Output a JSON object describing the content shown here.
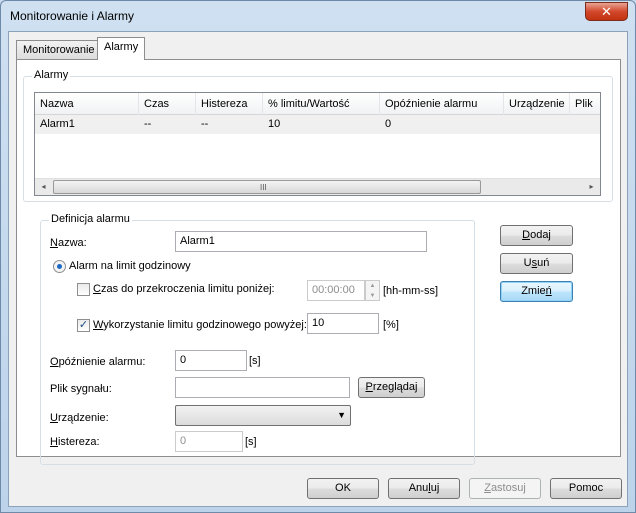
{
  "window": {
    "title": "Monitorowanie i Alarmy",
    "close_glyph": "✕"
  },
  "tabs": [
    {
      "label": "Monitorowanie"
    },
    {
      "label": "Alarmy"
    }
  ],
  "alarms_group": {
    "label": "Alarmy",
    "columns": [
      "Nazwa",
      "Czas",
      "Histereza",
      "% limitu/Wartość",
      "Opóźnienie alarmu",
      "Urządzenie",
      "Plik"
    ],
    "rows": [
      {
        "cells": [
          "Alarm1",
          "--",
          "--",
          "10",
          "0",
          "",
          ""
        ]
      }
    ],
    "scroll_left": "◂",
    "scroll_right": "▸",
    "thumb_grip": "III"
  },
  "definition": {
    "label": "Definicja alarmu",
    "name_label_u": "N",
    "name_label_rest": "azwa:",
    "name_value": "Alarm1",
    "radio_label": "Alarm na limit godzinowy",
    "cb1_label_u": "C",
    "cb1_label_rest": "zas do przekroczenia limitu poniżej:",
    "time_value": "00:00:00",
    "time_unit": "[hh-mm-ss]",
    "spin_up": "▲",
    "spin_down": "▼",
    "cb2_label_u": "W",
    "cb2_label_rest": "ykorzystanie limitu godzinowego powyżej:",
    "cb2_checkmark": "✓",
    "percent_value": "10",
    "percent_unit": "[%]",
    "delay_label_u": "O",
    "delay_label_rest": "późnienie alarmu:",
    "delay_value": "0",
    "delay_unit": "[s]",
    "signal_label": "Plik sygnału:",
    "signal_value": "",
    "browse_u": "P",
    "browse_rest": "rzeglądaj",
    "device_label_u": "U",
    "device_label_rest": "rządzenie:",
    "device_arrow": "▼",
    "hysteresis_label_u": "H",
    "hysteresis_label_rest": "istereza:",
    "hysteresis_value": "0",
    "hysteresis_unit": "[s]"
  },
  "side_buttons": {
    "add_u": "D",
    "add_rest": "odaj",
    "remove_pre": "U",
    "remove_u": "s",
    "remove_rest": "uń",
    "change_pre": "Zmie",
    "change_u": "ń"
  },
  "footer": {
    "ok": "OK",
    "cancel_pre": "Anu",
    "cancel_u": "l",
    "cancel_rest": "uj",
    "apply_u": "Z",
    "apply_rest": "astosuj",
    "help": "Pomoc"
  }
}
